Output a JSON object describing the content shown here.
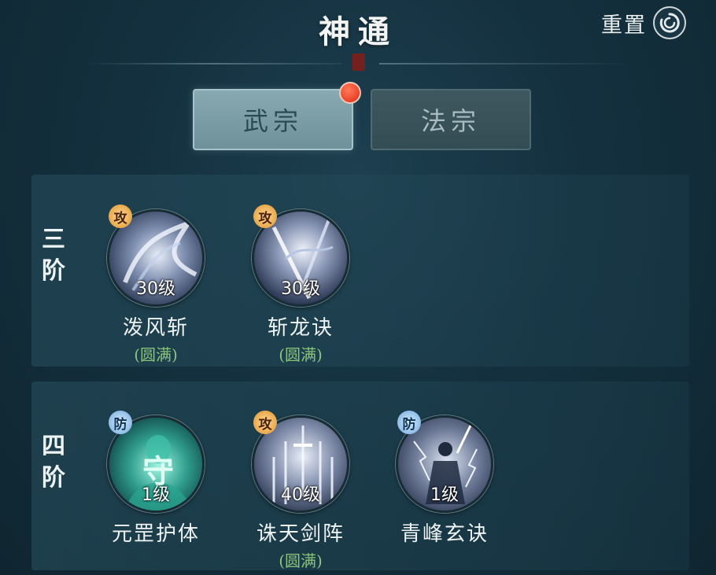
{
  "header": {
    "title": "神通",
    "reset_label": "重置"
  },
  "tabs": [
    {
      "label": "武宗",
      "active": true
    },
    {
      "label": "法宗",
      "active": false
    }
  ],
  "tiers": [
    {
      "label": "三阶",
      "skills": [
        {
          "name": "泼风斩",
          "level": "30级",
          "type_label": "攻",
          "status": "(圆满)"
        },
        {
          "name": "斩龙诀",
          "level": "30级",
          "type_label": "攻",
          "status": "(圆满)"
        }
      ]
    },
    {
      "label": "四阶",
      "skills": [
        {
          "name": "元罡护体",
          "level": "1级",
          "type_label": "防",
          "status": "",
          "icon_glyph": "守"
        },
        {
          "name": "诛天剑阵",
          "level": "40级",
          "type_label": "攻",
          "status": "(圆满)"
        },
        {
          "name": "青峰玄诀",
          "level": "1级",
          "type_label": "防",
          "status": ""
        }
      ]
    }
  ],
  "colors": {
    "accent_green": "#8bc47d",
    "notification_red": "#ec4a2e"
  }
}
